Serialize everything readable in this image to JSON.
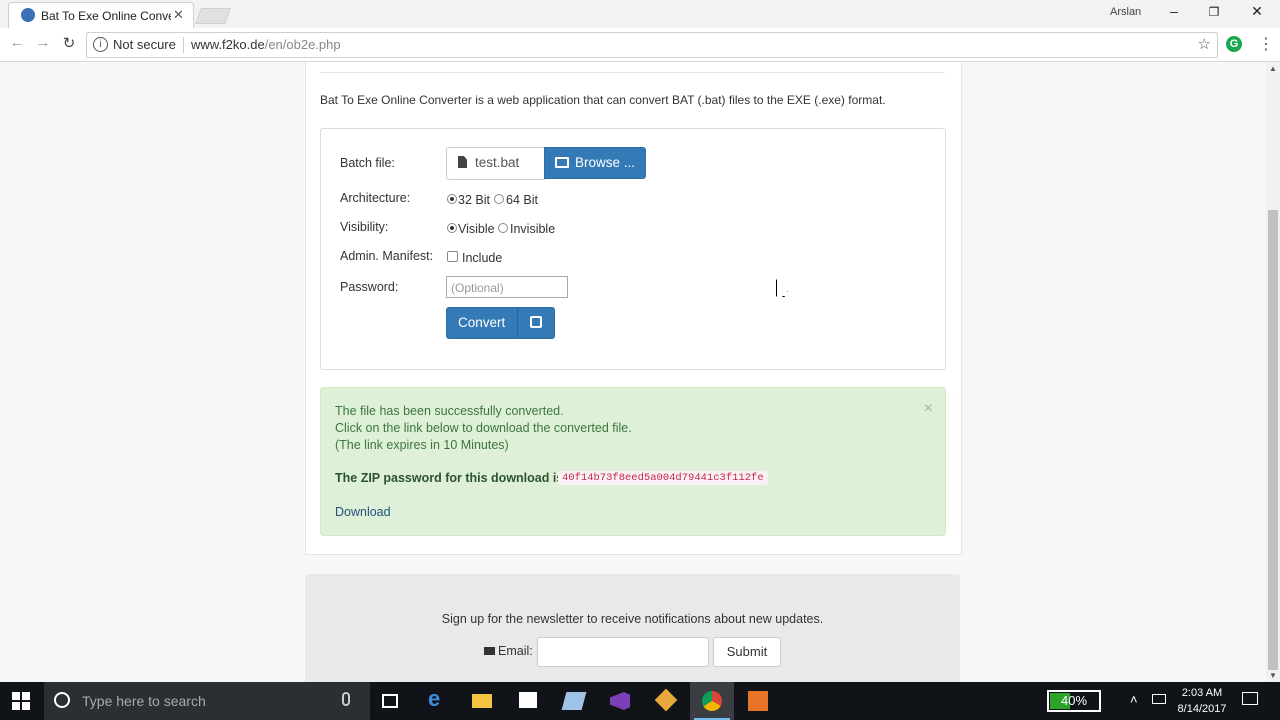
{
  "browser": {
    "tab_title": "Bat To Exe Online Conver",
    "tab_close": "✕",
    "user_name": "Arslan",
    "security_label": "Not secure",
    "url_domain": "www.f2ko.de",
    "url_path": "/en/ob2e.php"
  },
  "page": {
    "intro": "Bat To Exe Online Converter is a web application that can convert BAT (.bat) files to the EXE (.exe) format.",
    "form": {
      "batch_label": "Batch file:",
      "file_name": "test.bat",
      "browse_label": "Browse ...",
      "arch_label": "Architecture:",
      "arch_options": [
        "32 Bit",
        "64 Bit"
      ],
      "arch_selected": "32 Bit",
      "vis_label": "Visibility:",
      "vis_options": [
        "Visible",
        "Invisible"
      ],
      "vis_selected": "Visible",
      "manifest_label": "Admin. Manifest:",
      "manifest_option": "Include",
      "password_label": "Password:",
      "password_placeholder": "(Optional)",
      "convert_label": "Convert"
    },
    "alert": {
      "line1": "The file has been successfully converted.",
      "line2": "Click on the link below to download the converted file.",
      "line3": "(The link expires in 10 Minutes)",
      "zip_label": "The ZIP password for this download is:",
      "zip_password": "40f14b73f8eed5a004d79441c3f112fe",
      "download_label": "Download",
      "close": "×"
    },
    "newsletter": {
      "text": "Sign up for the newsletter to receive notifications about new updates.",
      "email_label": "Email:",
      "submit_label": "Submit"
    }
  },
  "taskbar": {
    "search_placeholder": "Type here to search",
    "battery_percent": "40%",
    "time": "2:03 AM",
    "date": "8/14/2017"
  },
  "colors": {
    "primary": "#337ab7",
    "success_bg": "#dff0d8",
    "success_text": "#3c763d",
    "code_text": "#c7254e"
  }
}
